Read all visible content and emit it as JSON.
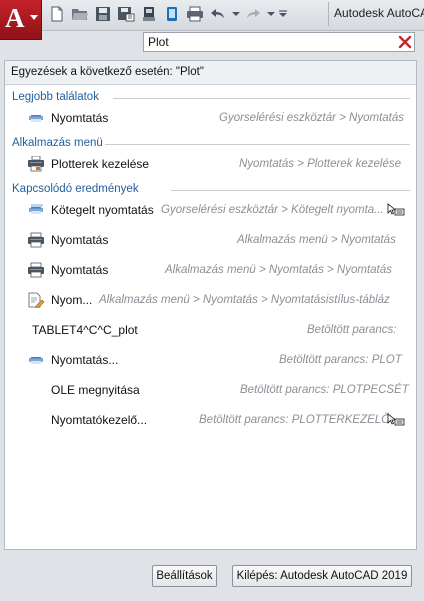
{
  "app_title": "Autodesk AutoCAD",
  "colors": {
    "app_button": "#b81d24",
    "section_heading": "#1f5f9e",
    "path_text": "#8a8f96",
    "clear_icon": "#c62828"
  },
  "quick_access": [
    "new-icon",
    "open-icon",
    "save-icon",
    "save-as-icon",
    "publish-icon",
    "share-icon",
    "plot-icon",
    "undo-icon",
    "redo-icon",
    "customize-dropdown-icon"
  ],
  "search": {
    "value": "Plot"
  },
  "results_header": "Egyezések a következő esetén: \"Plot\"",
  "sections": {
    "best": "Legjobb találatok",
    "menu": "Alkalmazás menü",
    "related": "Kapcsolódó eredmények"
  },
  "results": [
    {
      "name": "Nyomtatás",
      "path": "Gyorselérési eszköztár > Nyomtatás",
      "icon": "plot-icon"
    },
    {
      "name": "Plotterek kezelése",
      "path": "Nyomtatás > Plotterek kezelése",
      "icon": "plotter-manager-icon"
    },
    {
      "name": "Kötegelt nyomtatás",
      "path": "Gyorselérési eszköztár > Kötegelt nyomta...",
      "icon": "batch-plot-icon",
      "cursor": true
    },
    {
      "name": "Nyomtatás",
      "path": "Alkalmazás menü > Nyomtatás",
      "icon": "printer-icon"
    },
    {
      "name": "Nyomtatás",
      "path": "Alkalmazás menü > Nyomtatás > Nyomtatás",
      "icon": "printer-icon"
    },
    {
      "name": "Nyom...",
      "path": "Alkalmazás menü > Nyomtatás > Nyomtatásistílus-tábláz",
      "icon": "plot-style-icon"
    },
    {
      "name": "TABLET4^C^C_plot",
      "path": "Betöltött parancs:",
      "icon": ""
    },
    {
      "name": "Nyomtatás...",
      "path": "Betöltött parancs: PLOT",
      "icon": "plot-icon"
    },
    {
      "name": "OLE megnyitása",
      "path": "Betöltött parancs: PLOTPECSÉT",
      "icon": ""
    },
    {
      "name": "Nyomtatókezelő...",
      "path": "Betöltött parancs: PLOTTERKEZELŐ",
      "icon": "",
      "cursor": true
    }
  ],
  "buttons": {
    "options": "Beállítások",
    "exit": "Kilépés: Autodesk AutoCAD 2019"
  }
}
